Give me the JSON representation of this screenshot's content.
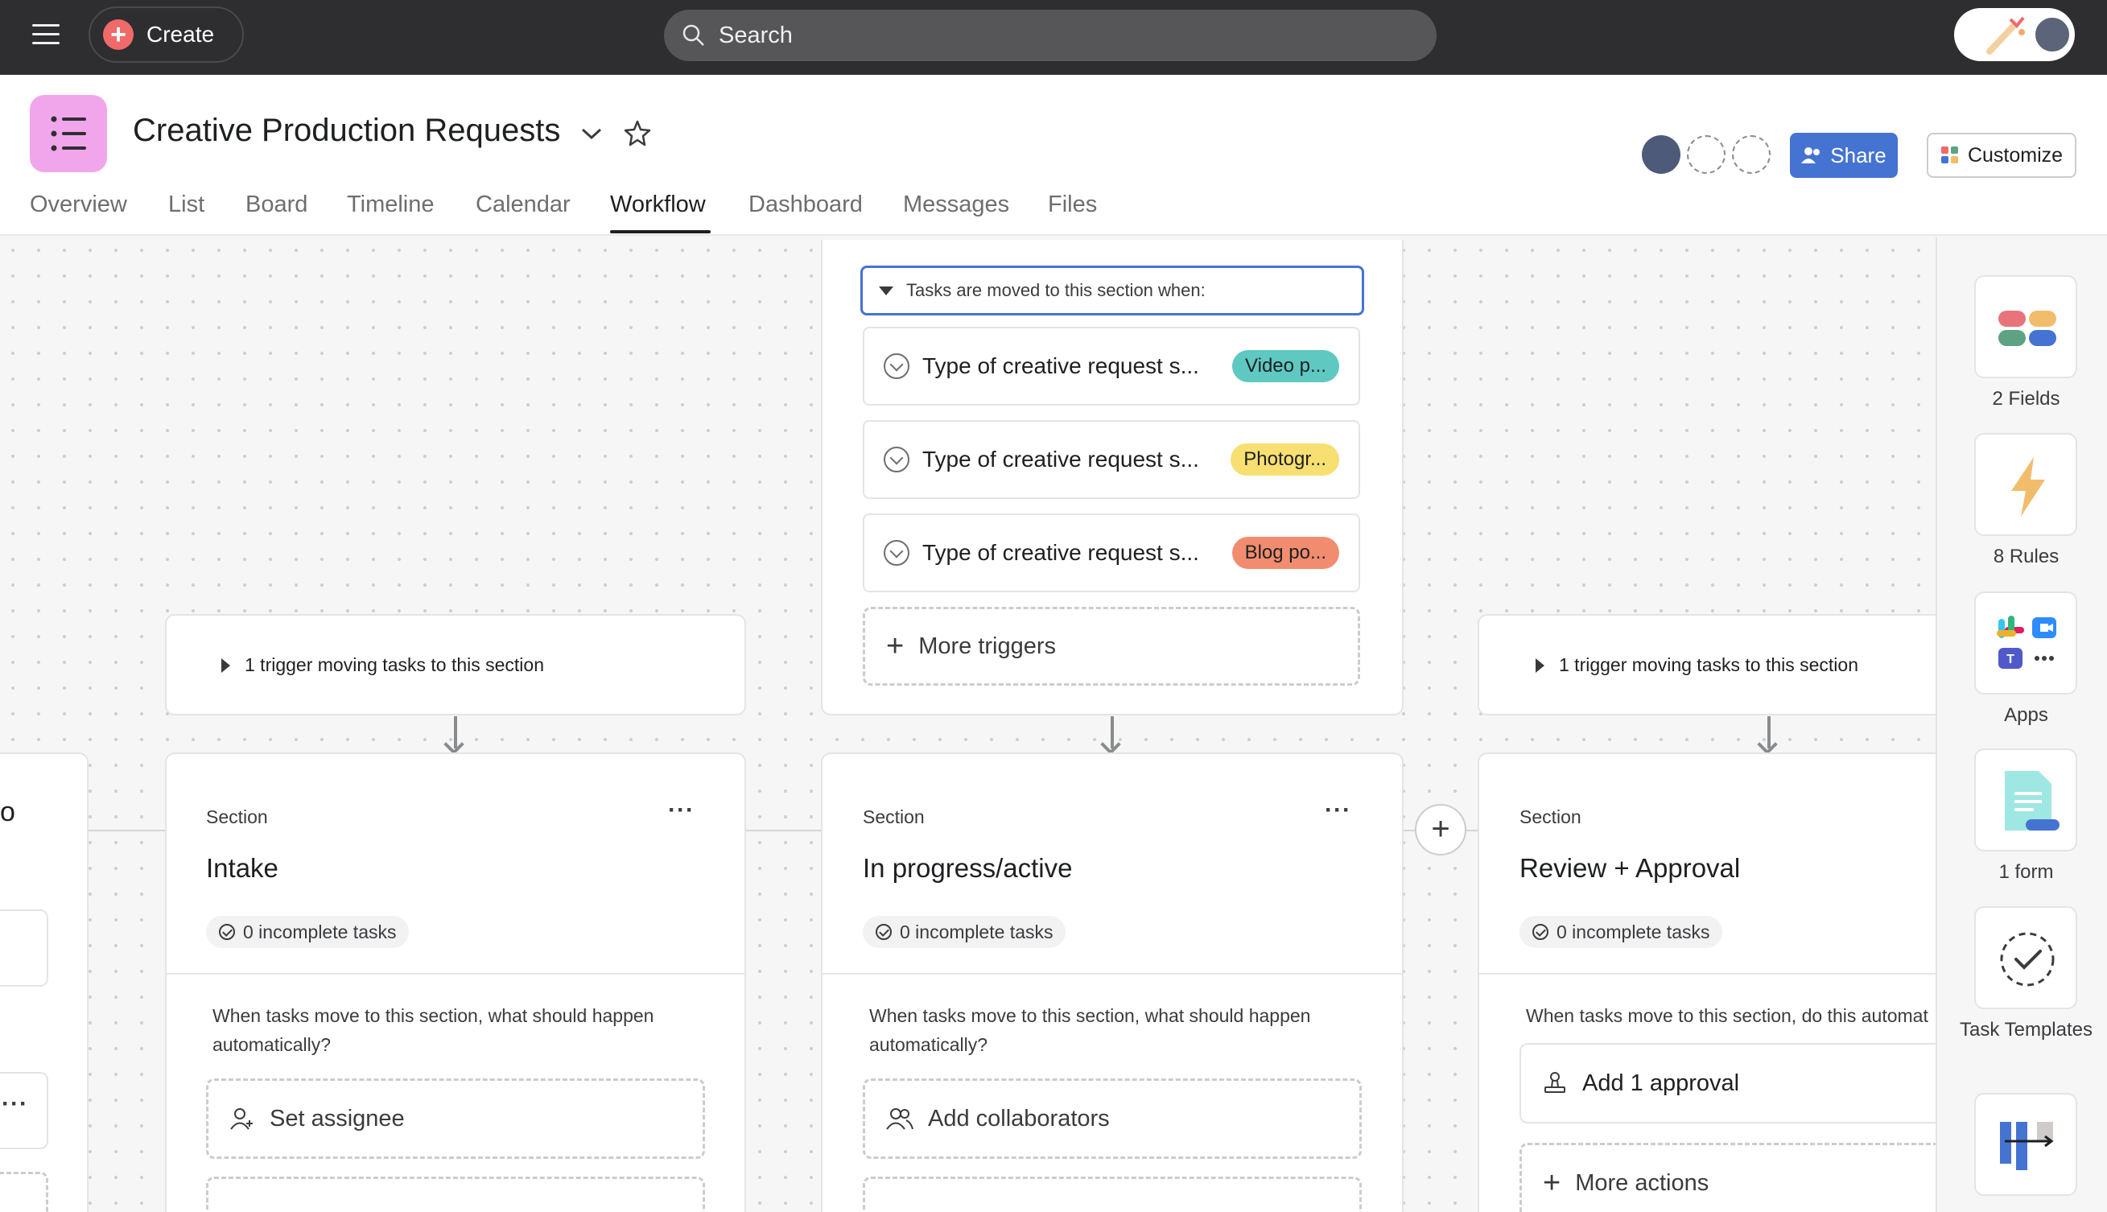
{
  "topbar": {
    "create_label": "Create",
    "search_placeholder": "Search"
  },
  "project": {
    "title": "Creative Production Requests",
    "share_label": "Share",
    "customize_label": "Customize"
  },
  "tabs": [
    {
      "label": "Overview"
    },
    {
      "label": "List"
    },
    {
      "label": "Board"
    },
    {
      "label": "Timeline"
    },
    {
      "label": "Calendar"
    },
    {
      "label": "Workflow",
      "active": true
    },
    {
      "label": "Dashboard"
    },
    {
      "label": "Messages"
    },
    {
      "label": "Files"
    }
  ],
  "workflow": {
    "left_trigger": "1 trigger moving tasks to this section",
    "right_trigger": "1 trigger moving tasks to this section",
    "center_trigger_header": "Tasks are moved to this section when:",
    "conditions": [
      {
        "text": "Type of creative request s...",
        "tag": "Video p...",
        "tag_color": "#5ec8c1"
      },
      {
        "text": "Type of creative request s...",
        "tag": "Photogr...",
        "tag_color": "#f8df72"
      },
      {
        "text": "Type of creative request s...",
        "tag": "Blog po...",
        "tag_color": "#f18d6e"
      }
    ],
    "more_triggers": "More triggers",
    "partial_left_letter": "o",
    "sections": [
      {
        "label": "Section",
        "name": "Intake",
        "incomplete": "0 incomplete tasks",
        "when_text": "When tasks move to this section, what should happen automatically?",
        "action": "Set assignee"
      },
      {
        "label": "Section",
        "name": "In progress/active",
        "incomplete": "0 incomplete tasks",
        "when_text": "When tasks move to this section, what should happen automatically?",
        "action": "Add collaborators"
      },
      {
        "label": "Section",
        "name": "Review + Approval",
        "incomplete": "0 incomplete tasks",
        "when_text": "When tasks move to this section, do this automat",
        "action": "Add 1 approval",
        "more_actions": "More actions"
      }
    ]
  },
  "sidebar": {
    "items": [
      {
        "label": "2 Fields",
        "icon": "fields-icon"
      },
      {
        "label": "8 Rules",
        "icon": "lightning-icon"
      },
      {
        "label": "Apps",
        "icon": "apps-icon"
      },
      {
        "label": "1 form",
        "icon": "form-icon"
      },
      {
        "label": "Task Templates",
        "icon": "task-template-icon"
      },
      {
        "label": "",
        "icon": "sections-icon"
      }
    ]
  }
}
